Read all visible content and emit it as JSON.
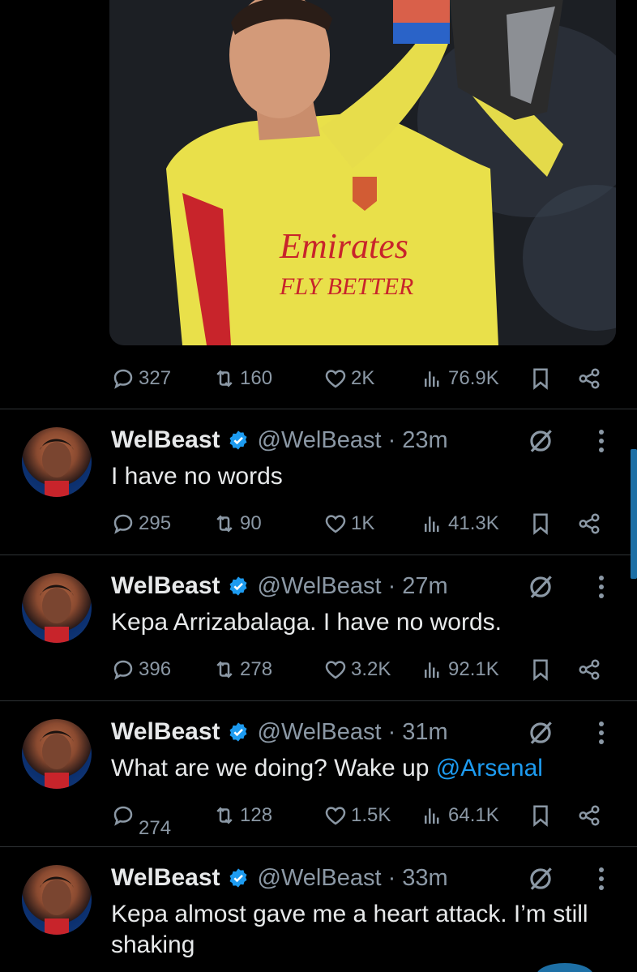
{
  "top_tweet": {
    "media_alt": "Emirates FLY BETTER",
    "stats": {
      "replies": "327",
      "reposts": "160",
      "likes": "2K",
      "views": "76.9K"
    }
  },
  "tweets": [
    {
      "name": "WelBeast",
      "handle": "@WelBeast · 23m",
      "text": "I have no words",
      "mention": "",
      "stats": {
        "replies": "295",
        "reposts": "90",
        "likes": "1K",
        "views": "41.3K"
      }
    },
    {
      "name": "WelBeast",
      "handle": "@WelBeast · 27m",
      "text": "Kepa Arrizabalaga. I have no words.",
      "mention": "",
      "stats": {
        "replies": "396",
        "reposts": "278",
        "likes": "3.2K",
        "views": "92.1K"
      }
    },
    {
      "name": "WelBeast",
      "handle": "@WelBeast · 31m",
      "text": "What are we doing? Wake up ",
      "mention": "@Arsenal",
      "stats": {
        "replies": "274",
        "reposts": "128",
        "likes": "1.5K",
        "views": "64.1K"
      }
    },
    {
      "name": "WelBeast",
      "handle": "@WelBeast · 33m",
      "text": "Kepa almost gave me a heart attack. I’m still shaking",
      "mention": "",
      "stats": {
        "replies": "",
        "reposts": "",
        "likes": "",
        "views": ""
      }
    }
  ],
  "icons": {
    "reply": "reply-icon",
    "repost": "repost-icon",
    "like": "like-icon",
    "views": "views-icon",
    "bookmark": "bookmark-icon",
    "share": "share-icon",
    "verified": "verified-badge-icon",
    "grok": "grok-icon",
    "more": "more-icon"
  },
  "colors": {
    "background": "#000000",
    "text_primary": "#e7e9ea",
    "text_secondary": "#8b98a5",
    "accent": "#1d9bf0",
    "divider": "#2f3336"
  }
}
